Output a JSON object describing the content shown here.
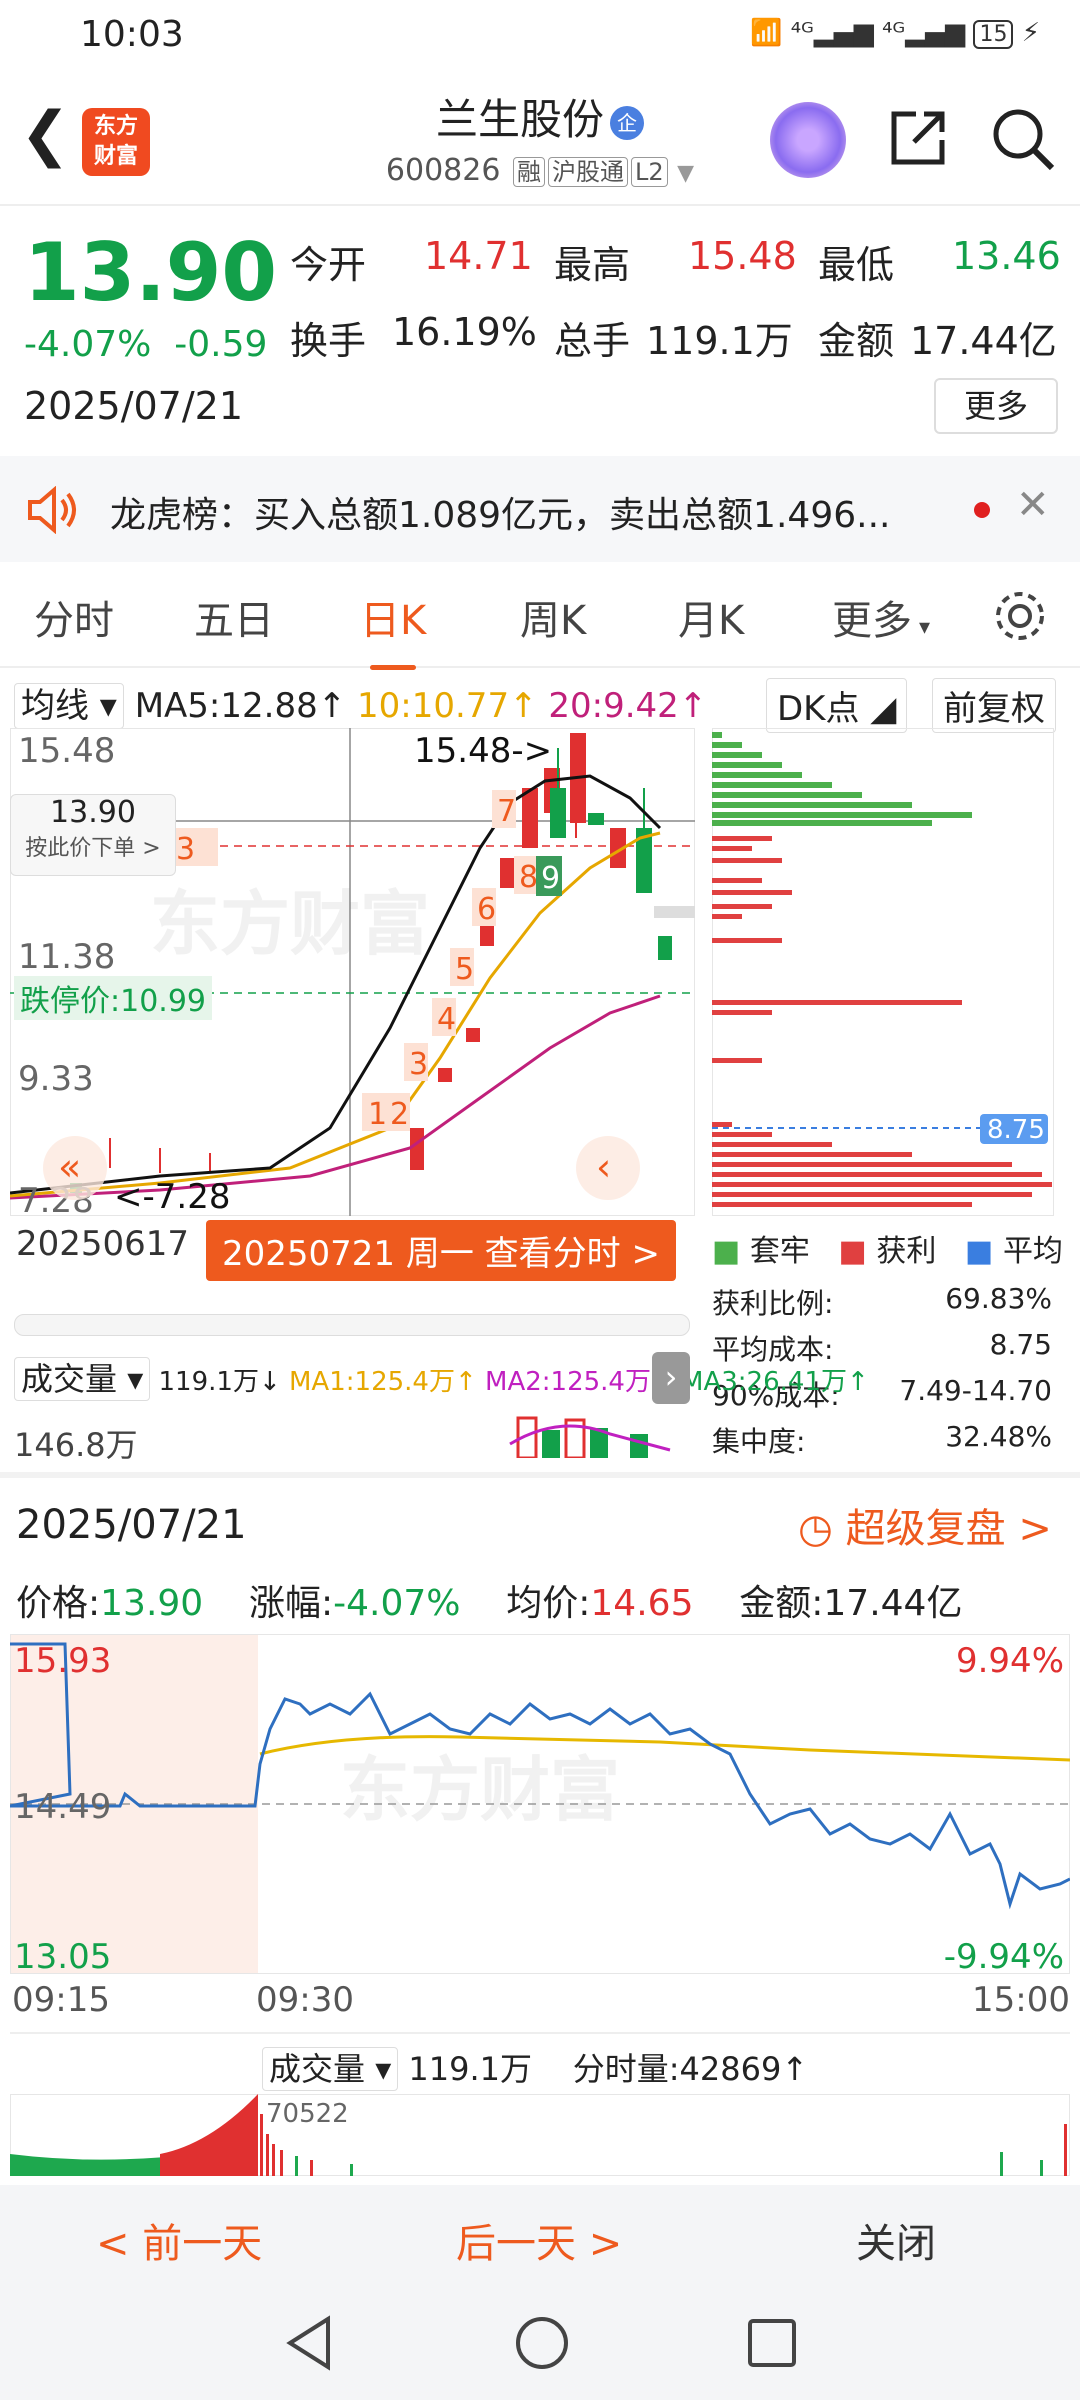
{
  "status": {
    "time": "10:03",
    "battery": "15"
  },
  "header": {
    "title": "兰生股份",
    "badge": "企",
    "code": "600826",
    "tags": [
      "融",
      "沪股通",
      "L2"
    ]
  },
  "quote": {
    "price": "13.90",
    "pct": "-4.07%",
    "chg": "-0.59",
    "date": "2025/07/21",
    "open_label": "今开",
    "open": "14.71",
    "high_label": "最高",
    "high": "15.48",
    "low_label": "最低",
    "low": "13.46",
    "turnover_label": "换手",
    "turnover": "16.19%",
    "vol_label": "总手",
    "vol": "119.1万",
    "amt_label": "金额",
    "amt": "17.44亿",
    "more": "更多"
  },
  "notice": {
    "text": "龙虎榜：买入总额1.089亿元，卖出总额1.496..."
  },
  "tabs": [
    "分时",
    "五日",
    "日K",
    "周K",
    "月K",
    "更多"
  ],
  "kline": {
    "ma_selector": "均线",
    "ma5": "MA5:12.88↑",
    "ma10": "10:10.77↑",
    "ma20": "20:9.42↑",
    "dk": "DK点",
    "fq": "前复权",
    "y_labels": [
      "15.48",
      "11.38",
      "9.33",
      "7.28"
    ],
    "high_annot": "15.48->",
    "low_annot": "<-7.28",
    "limit_down": "跌停价:10.99",
    "cursor_price": "13.90",
    "cursor_hint": "按此价下单 >",
    "date_left": "20250617",
    "view_btn": "20250721 周一 查看分时 >",
    "numbers": [
      "1",
      "2",
      "3",
      "4",
      "5",
      "6",
      "7",
      "8",
      "9",
      "3"
    ],
    "vol_selector": "成交量",
    "vol_line": "119.1万↓",
    "ma1": "MA1:125.4万↑",
    "ma2": "MA2:125.4万↑",
    "ma3": "MA3:26.41万↑",
    "vol_axis": "146.8万",
    "chip_avg": "8.75",
    "chip_legend": [
      "套牢",
      "获利",
      "平均"
    ],
    "chip_stats": [
      {
        "k": "获利比例:",
        "v": "69.83%"
      },
      {
        "k": "平均成本:",
        "v": "8.75"
      },
      {
        "k": "90%成本:",
        "v": "7.49-14.70"
      },
      {
        "k": "集中度:",
        "v": "32.48%"
      }
    ]
  },
  "intraday": {
    "date": "2025/07/21",
    "replay": "超级复盘 >",
    "price_label": "价格:",
    "price": "13.90",
    "pct_label": "涨幅:",
    "pct": "-4.07%",
    "avg_label": "均价:",
    "avg": "14.65",
    "amt_label": "金额:",
    "amt": "17.44亿",
    "y_top": "15.93",
    "y_mid": "14.49",
    "y_bot": "13.05",
    "pct_top": "9.94%",
    "pct_bot": "-9.94%",
    "t0": "09:15",
    "t1": "09:30",
    "t2": "15:00",
    "vol_selector": "成交量",
    "vol": "119.1万",
    "fsl": "分时量:42869↑",
    "vol_max": "70522"
  },
  "bottom": {
    "prev": "< 前一天",
    "next": "后一天 >",
    "close": "关闭"
  },
  "colors": {
    "accent": "#ee5a1e",
    "up": "#e03030",
    "down": "#12a04a"
  }
}
